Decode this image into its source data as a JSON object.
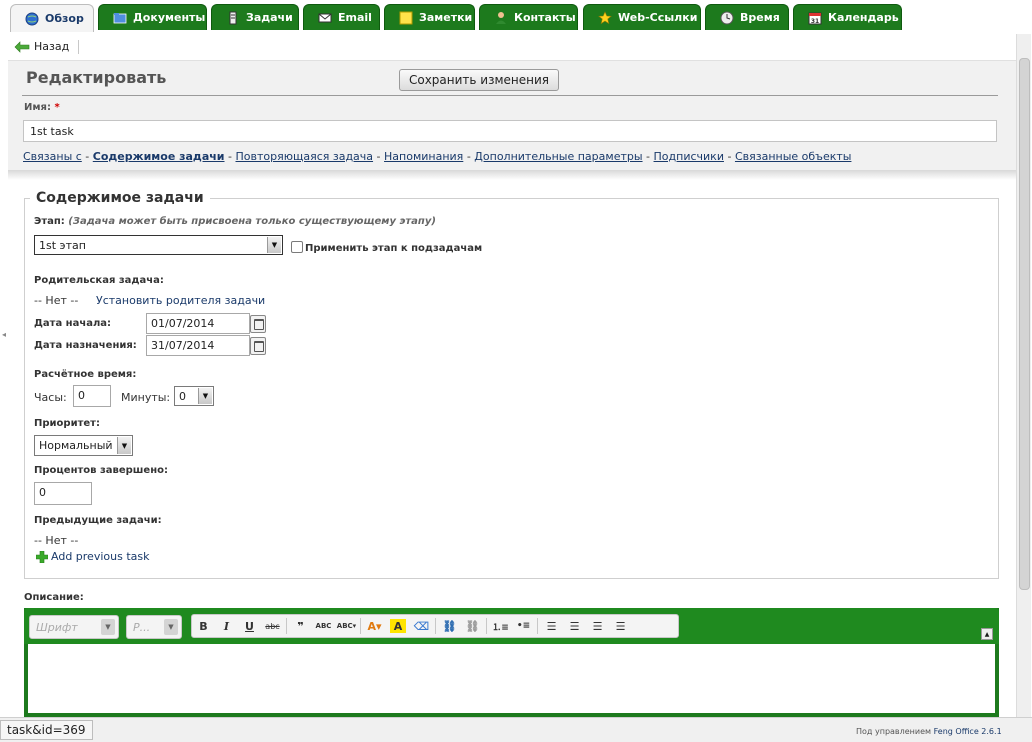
{
  "tabs": [
    {
      "label": "Обзор",
      "icon": "globe-icon",
      "active": true
    },
    {
      "label": "Документы",
      "icon": "documents-icon"
    },
    {
      "label": "Задачи",
      "icon": "tasks-icon"
    },
    {
      "label": "Email",
      "icon": "email-icon"
    },
    {
      "label": "Заметки",
      "icon": "notes-icon"
    },
    {
      "label": "Контакты",
      "icon": "contacts-icon"
    },
    {
      "label": "Web-Ссылки",
      "icon": "star-icon"
    },
    {
      "label": "Время",
      "icon": "clock-icon"
    },
    {
      "label": "Календарь",
      "icon": "calendar-icon"
    }
  ],
  "back_label": "Назад",
  "header": {
    "title": "Редактировать",
    "save_label": "Сохранить изменения",
    "name_label": "Имя:",
    "required_mark": "*",
    "name_value": "1st task"
  },
  "section_links": [
    "Связаны с",
    "Содержимое задачи",
    "Повторяющаяся задача",
    "Напоминания",
    "Дополнительные параметры",
    "Подписчики",
    "Связанные объекты"
  ],
  "section_sep": "-",
  "content": {
    "legend": "Содержимое задачи",
    "stage_label": "Этап:",
    "stage_hint": "(Задача может быть присвоена только существующему этапу)",
    "stage_value": "1st этап",
    "apply_stage_label": "Применить этап к подзадачам",
    "parent_label": "Родительская задача:",
    "parent_none": "-- Нет --",
    "set_parent_link": "Установить родителя задачи",
    "start_label": "Дата начала:",
    "start_value": "01/07/2014",
    "due_label": "Дата назначения:",
    "due_value": "31/07/2014",
    "estimate_label": "Расчётное время:",
    "hours_label": "Часы:",
    "hours_value": "0",
    "minutes_label": "Минуты:",
    "minutes_value": "0",
    "priority_label": "Приоритет:",
    "priority_value": "Нормальный",
    "percent_label": "Процентов завершено:",
    "percent_value": "0",
    "prev_label": "Предыдущие задачи:",
    "prev_none": "-- Нет --",
    "add_prev_link": "Add previous task"
  },
  "description": {
    "label": "Описание:",
    "font_placeholder": "Шрифт",
    "size_placeholder": "Р..."
  },
  "toolbar_buttons": [
    "B",
    "I",
    "U",
    "abc"
  ],
  "status": {
    "url_fragment": "task&id=369",
    "powered_text": "Под управлением",
    "product": "Feng Office 2.6.1"
  }
}
